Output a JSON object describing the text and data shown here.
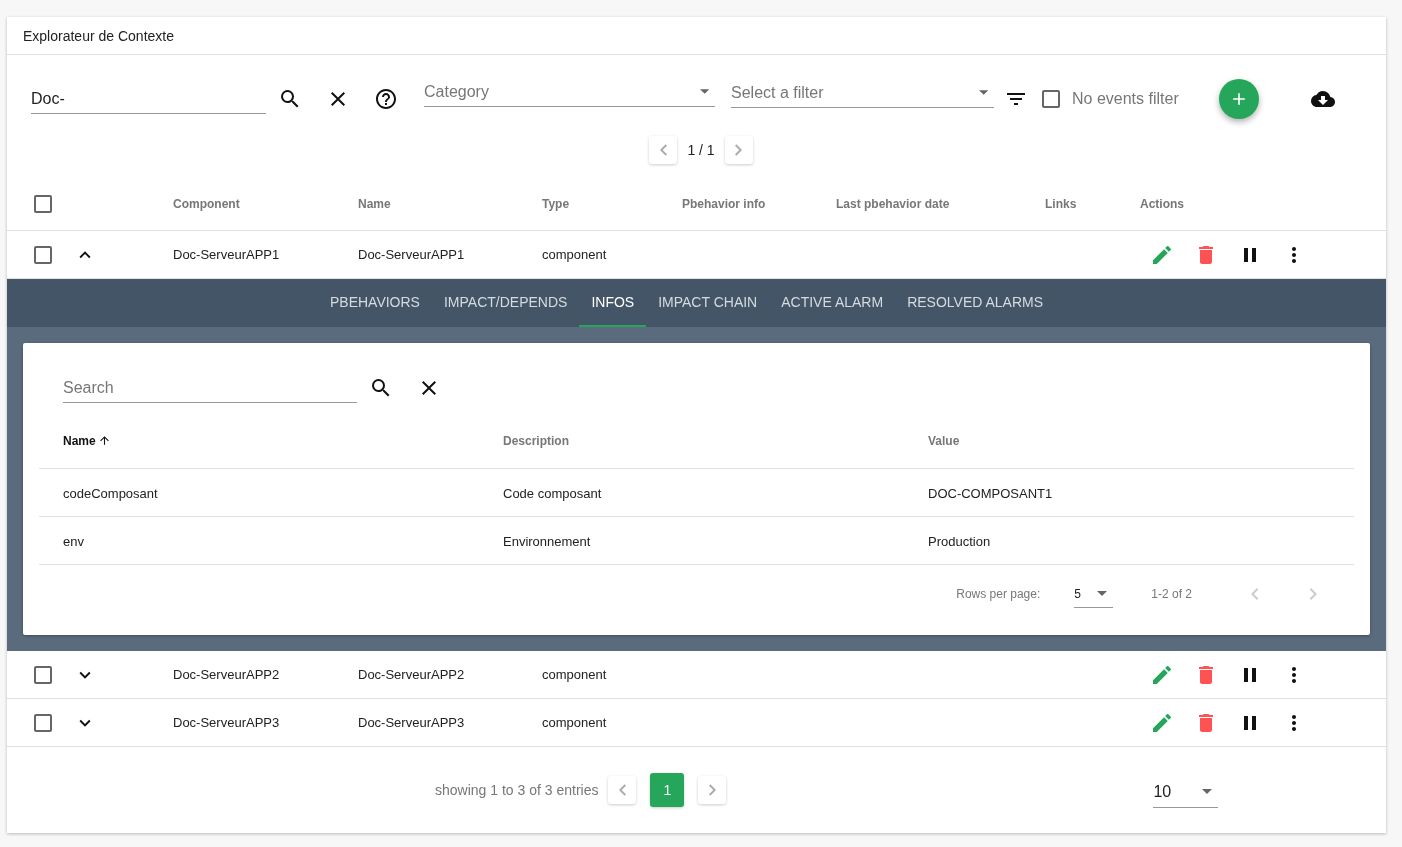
{
  "window": {
    "title": "Explorateur de Contexte"
  },
  "toolbar": {
    "search": {
      "value": "Doc-"
    },
    "category": {
      "placeholder": "Category"
    },
    "filter": {
      "placeholder": "Select a filter"
    },
    "no_events_filter": {
      "label": "No events filter",
      "checked": false
    }
  },
  "top_pager": {
    "label": "1 / 1"
  },
  "table": {
    "select_all": {
      "checked": false
    },
    "columns": [
      "Component",
      "Name",
      "Type",
      "Pbehavior info",
      "Last pbehavior date",
      "Links",
      "Actions"
    ],
    "rows": [
      {
        "component": "Doc-ServeurAPP1",
        "name": "Doc-ServeurAPP1",
        "type": "component",
        "checked": false,
        "expanded": true,
        "details": {
          "tabs": [
            {
              "label": "PBEHAVIORS",
              "selected": false
            },
            {
              "label": "IMPACT/DEPENDS",
              "selected": false
            },
            {
              "label": "INFOS",
              "selected": true
            },
            {
              "label": "IMPACT CHAIN",
              "selected": false
            },
            {
              "label": "ACTIVE ALARM",
              "selected": false
            },
            {
              "label": "RESOLVED ALARMS",
              "selected": false
            }
          ],
          "search": {
            "placeholder": "Search"
          },
          "columns": [
            {
              "label": "Name",
              "sorted": true
            },
            {
              "label": "Description",
              "sorted": false
            },
            {
              "label": "Value",
              "sorted": false
            }
          ],
          "rows": [
            {
              "name": "codeComposant",
              "description": "Code composant",
              "value": "DOC-COMPOSANT1"
            },
            {
              "name": "env",
              "description": "Environnement",
              "value": "Production"
            }
          ],
          "footer": {
            "rows_per_page_label": "Rows per page:",
            "rows_per_page": "5",
            "range": "1-2 of 2"
          }
        }
      },
      {
        "component": "Doc-ServeurAPP2",
        "name": "Doc-ServeurAPP2",
        "type": "component",
        "checked": false,
        "expanded": false
      },
      {
        "component": "Doc-ServeurAPP3",
        "name": "Doc-ServeurAPP3",
        "type": "component",
        "checked": false,
        "expanded": false
      }
    ]
  },
  "footer": {
    "showing": "showing 1 to 3 of 3 entries",
    "pages": [
      {
        "label": "1",
        "selected": true
      }
    ],
    "per_page": "10"
  }
}
